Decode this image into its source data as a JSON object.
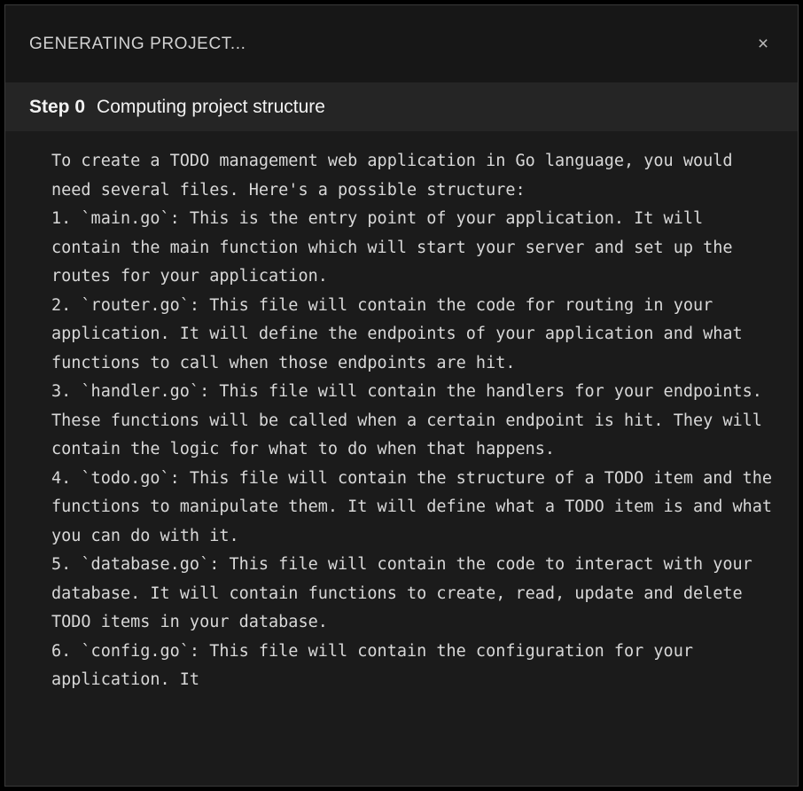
{
  "window": {
    "title": "GENERATING PROJECT...",
    "close_icon": "close-icon",
    "close_glyph": "×",
    "colors": {
      "titlebar_bg": "#171717",
      "step_band_bg": "#252525",
      "body_bg": "#1b1b1b",
      "border": "#3a3a3a",
      "title_text": "#d2d2d2",
      "step_text": "#f2f2f2",
      "log_text": "#d8d8d8"
    }
  },
  "step": {
    "index_label": "Step 0",
    "title": "Computing project structure"
  },
  "log": {
    "text": "To create a TODO management web application in Go language, you would need several files. Here's a possible structure:\n1. `main.go`: This is the entry point of your application. It will contain the main function which will start your server and set up the routes for your application.\n2. `router.go`: This file will contain the code for routing in your application. It will define the endpoints of your application and what functions to call when those endpoints are hit.\n3. `handler.go`: This file will contain the handlers for your endpoints. These functions will be called when a certain endpoint is hit. They will contain the logic for what to do when that happens.\n4. `todo.go`: This file will contain the structure of a TODO item and the functions to manipulate them. It will define what a TODO item is and what you can do with it.\n5. `database.go`: This file will contain the code to interact with your database. It will contain functions to create, read, update and delete TODO items in your database.\n6. `config.go`: This file will contain the configuration for your application. It"
  }
}
